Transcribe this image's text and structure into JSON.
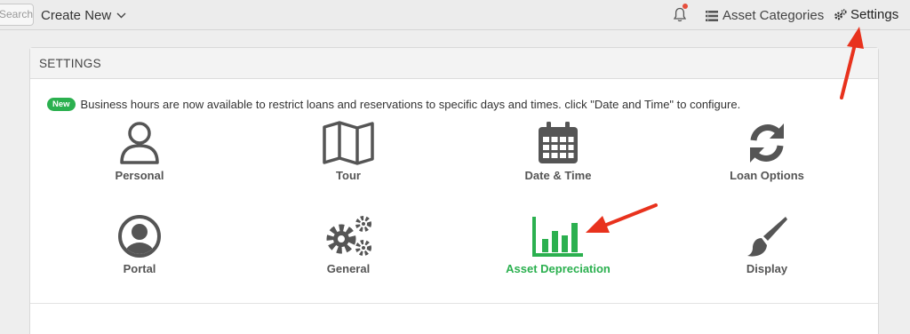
{
  "topbar": {
    "search_placeholder": "Search",
    "create_new_label": "Create New",
    "asset_categories_label": "Asset Categories",
    "settings_label": "Settings"
  },
  "panel": {
    "title": "SETTINGS",
    "notice_badge": "New",
    "notice_text": "Business hours are now available to restrict loans and reservations to specific days and times. click \"Date and Time\" to configure."
  },
  "tiles": [
    {
      "label": "Personal",
      "icon": "user-icon"
    },
    {
      "label": "Tour",
      "icon": "map-icon"
    },
    {
      "label": "Date & Time",
      "icon": "calendar-icon"
    },
    {
      "label": "Loan Options",
      "icon": "refresh-icon"
    },
    {
      "label": "Portal",
      "icon": "user-circle-icon"
    },
    {
      "label": "General",
      "icon": "gears-icon"
    },
    {
      "label": "Asset Depreciation",
      "icon": "bar-chart-icon"
    },
    {
      "label": "Display",
      "icon": "paint-brush-icon"
    }
  ],
  "colors": {
    "accent_green": "#2bb04f",
    "annotation_red": "#e8321d",
    "icon_gray": "#555555",
    "notification_dot": "#e64f3d"
  }
}
